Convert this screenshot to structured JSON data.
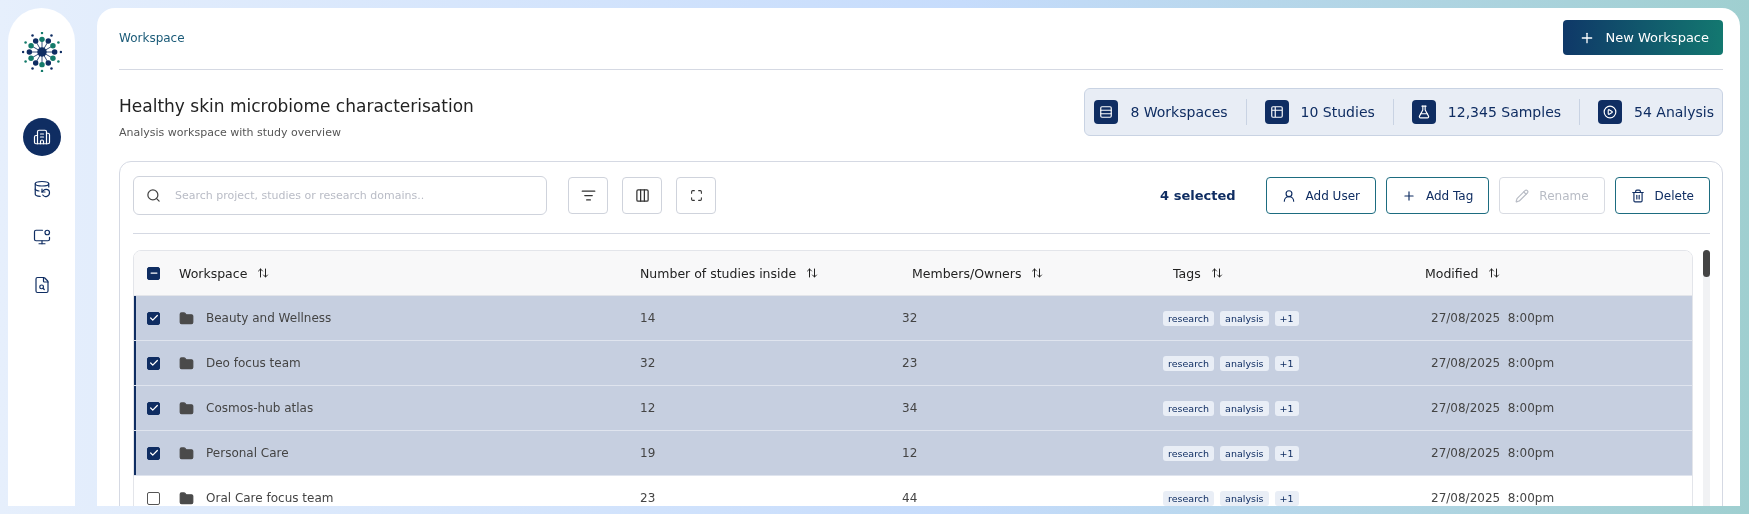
{
  "sidebar": {
    "items": [
      {
        "selected": true
      },
      {
        "selected": false
      },
      {
        "selected": false
      },
      {
        "selected": false
      }
    ]
  },
  "breadcrumb": "Workspace",
  "new_button": "New Workspace",
  "title": "Healthy skin microbiome characterisation",
  "subtitle": "Analysis workspace with study overview",
  "stats": [
    "8 Workspaces",
    "10 Studies",
    "12,345 Samples",
    "54 Analysis"
  ],
  "toolbar": {
    "search": {
      "placeholder": "Search project, studies or research domains.."
    },
    "selection": "4 selected",
    "actions": [
      {
        "label": "Add User",
        "disabled": false
      },
      {
        "label": "Add Tag",
        "disabled": false
      },
      {
        "label": "Rename",
        "disabled": true
      },
      {
        "label": "Delete",
        "disabled": false
      }
    ]
  },
  "table": {
    "select_all": {
      "checked": true,
      "partial": true
    },
    "columns": [
      "Workspace",
      "Number of studies inside",
      "Members/Owners",
      "Tags",
      "Modified"
    ],
    "rows": [
      {
        "selected": true,
        "name": "Beauty and Wellness",
        "studies": "14",
        "members": "32",
        "tags": [
          "research",
          "analysis",
          "+1"
        ],
        "date": "27/08/2025",
        "time": "8:00pm"
      },
      {
        "selected": true,
        "name": "Deo focus team",
        "studies": "32",
        "members": "23",
        "tags": [
          "research",
          "analysis",
          "+1"
        ],
        "date": "27/08/2025",
        "time": "8:00pm"
      },
      {
        "selected": true,
        "name": "Cosmos-hub atlas",
        "studies": "12",
        "members": "34",
        "tags": [
          "research",
          "analysis",
          "+1"
        ],
        "date": "27/08/2025",
        "time": "8:00pm"
      },
      {
        "selected": true,
        "name": "Personal Care",
        "studies": "19",
        "members": "12",
        "tags": [
          "research",
          "analysis",
          "+1"
        ],
        "date": "27/08/2025",
        "time": "8:00pm"
      },
      {
        "selected": false,
        "name": "Oral Care focus team",
        "studies": "23",
        "members": "44",
        "tags": [
          "research",
          "analysis",
          "+1"
        ],
        "date": "27/08/2025",
        "time": "8:00pm"
      }
    ]
  }
}
